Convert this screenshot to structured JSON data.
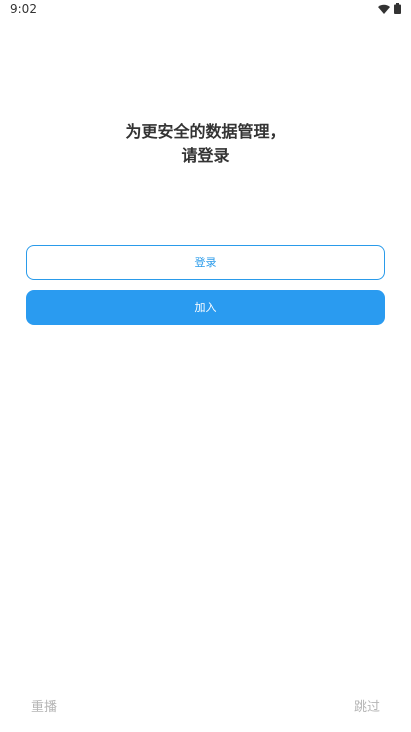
{
  "status_bar": {
    "time": "9:02",
    "icons": [
      "wifi-icon",
      "battery-icon"
    ]
  },
  "headline": {
    "line1": "为更安全的数据管理，",
    "line2": "请登录"
  },
  "buttons": {
    "login_label": "登录",
    "join_label": "加入"
  },
  "footer": {
    "replay_label": "重播",
    "skip_label": "跳过"
  },
  "colors": {
    "accent": "#2a9bf0",
    "footer_text": "#b5b5b5"
  }
}
